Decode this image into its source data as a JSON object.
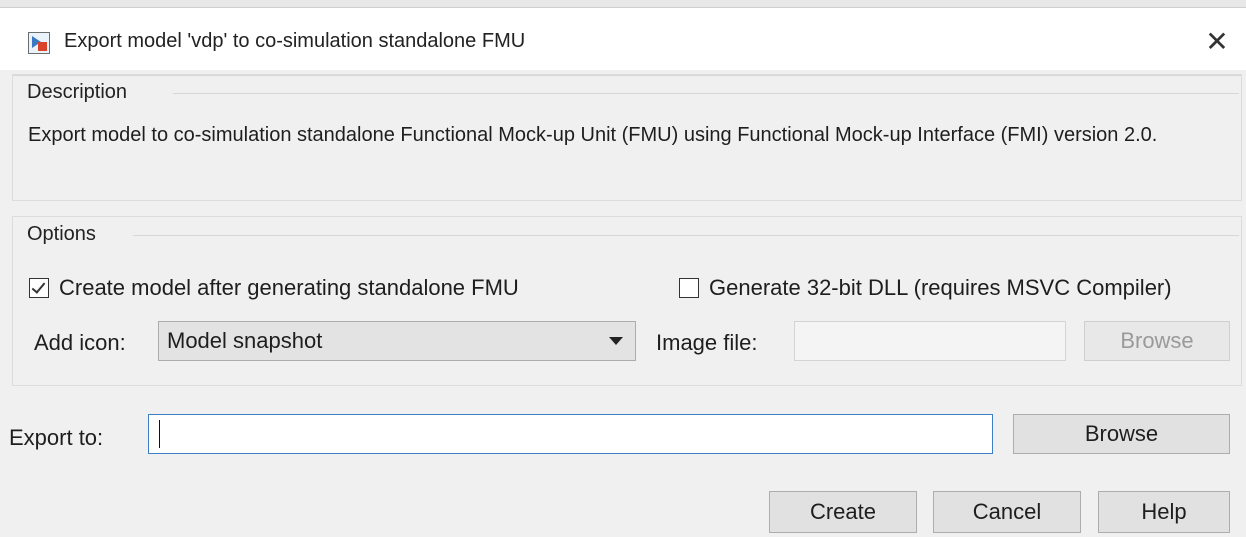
{
  "window": {
    "title": "Export model 'vdp' to co-simulation standalone FMU",
    "close_glyph": "✕"
  },
  "description": {
    "legend": "Description",
    "text": "Export model to co-simulation standalone Functional Mock-up Unit (FMU) using Functional Mock-up Interface (FMI) version 2.0."
  },
  "options": {
    "legend": "Options",
    "create_model": {
      "label": "Create model after generating standalone FMU",
      "checked": true
    },
    "generate_32bit": {
      "label": "Generate 32-bit DLL (requires MSVC Compiler)",
      "checked": false
    },
    "add_icon_label": "Add icon:",
    "add_icon_value": "Model snapshot",
    "image_file_label": "Image file:",
    "image_file_value": "",
    "image_browse_label": "Browse"
  },
  "export": {
    "label": "Export to:",
    "value": "",
    "browse_label": "Browse"
  },
  "footer": {
    "create_label": "Create",
    "cancel_label": "Cancel",
    "help_label": "Help"
  },
  "colors": {
    "dialog_bg": "#f0f0f0",
    "focus_border": "#3c7fc4",
    "button_bg": "#e1e1e1"
  }
}
